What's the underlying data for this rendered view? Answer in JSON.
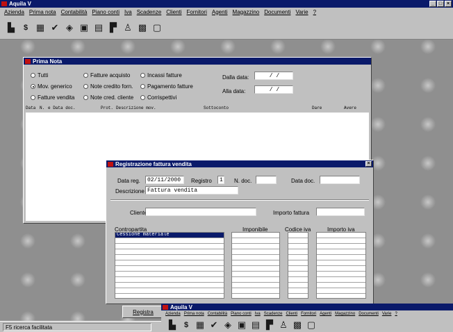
{
  "app": {
    "title": "Aquila V",
    "menu": [
      "Azienda",
      "Prima nota",
      "Contabilità",
      "Piano conti",
      "Iva",
      "Scadenze",
      "Clienti",
      "Fornitori",
      "Agenti",
      "Magazzino",
      "Documenti",
      "Varie",
      "?"
    ],
    "toolbar_icons": [
      "company-icon",
      "currency-icon",
      "ledger-icon",
      "checkmark-icon",
      "search-icon",
      "report-icon",
      "calculator-icon",
      "vat-icon",
      "agents-icon",
      "warehouse-icon",
      "documents-icon"
    ]
  },
  "prima_nota": {
    "title": "Prima Nota",
    "filters": [
      {
        "label": "Tutti",
        "selected": false
      },
      {
        "label": "Fatture acquisto",
        "selected": false
      },
      {
        "label": "Incassi fatture",
        "selected": false
      },
      {
        "label": "Mov. generico",
        "selected": true
      },
      {
        "label": "Note credito forn.",
        "selected": false
      },
      {
        "label": "Pagamento fatture",
        "selected": false
      },
      {
        "label": "Fatture vendita",
        "selected": false
      },
      {
        "label": "Note cred. cliente",
        "selected": false
      },
      {
        "label": "Corrispettivi",
        "selected": false
      }
    ],
    "dalla_data_label": "Dalla data:",
    "dalla_data_value": "/ /",
    "alla_data_label": "Alla data:",
    "alla_data_value": "/ /",
    "columns": [
      "Data",
      "N.",
      "e Data doc.",
      "Prot.",
      "Descrizione mov.",
      "Sottoconto",
      "Dare",
      "Avere"
    ]
  },
  "registrazione": {
    "title": "Registrazione fattura vendita",
    "data_reg_label": "Data reg.",
    "data_reg_value": "02/11/2000",
    "registro_label": "Registro",
    "registro_value": "1",
    "n_doc_label": "N. doc.",
    "n_doc_value": "",
    "data_doc_label": "Data doc.",
    "data_doc_value": "",
    "descrizione_label": "Descrizione",
    "descrizione_value": "Fattura vendita",
    "cliente_label": "Cliente",
    "cliente_value": "",
    "importo_fattura_label": "Importo fattura",
    "importo_fattura_value": "",
    "grid_headers": {
      "contropartita": "Contropartita",
      "imponibile": "Imponibile",
      "codice_iva": "Codice iva",
      "importo_iva": "Importo iva"
    },
    "first_row_value": "Cessione materiale"
  },
  "registra_button": "Registra",
  "second_app": {
    "title": "Aquila V",
    "menu": [
      "Azienda",
      "Prima nota",
      "Contabilità",
      "Piano conti",
      "Iva",
      "Scadenze",
      "Clienti",
      "Fornitori",
      "Agenti",
      "Magazzino",
      "Documenti",
      "Varie",
      "?"
    ]
  },
  "statusbar": {
    "text": "F5 ricerca facilitata"
  },
  "colors": {
    "titlebar": "#0a1a6a",
    "selected_row": "#0a1a6a",
    "app_icon": "#c01010"
  }
}
